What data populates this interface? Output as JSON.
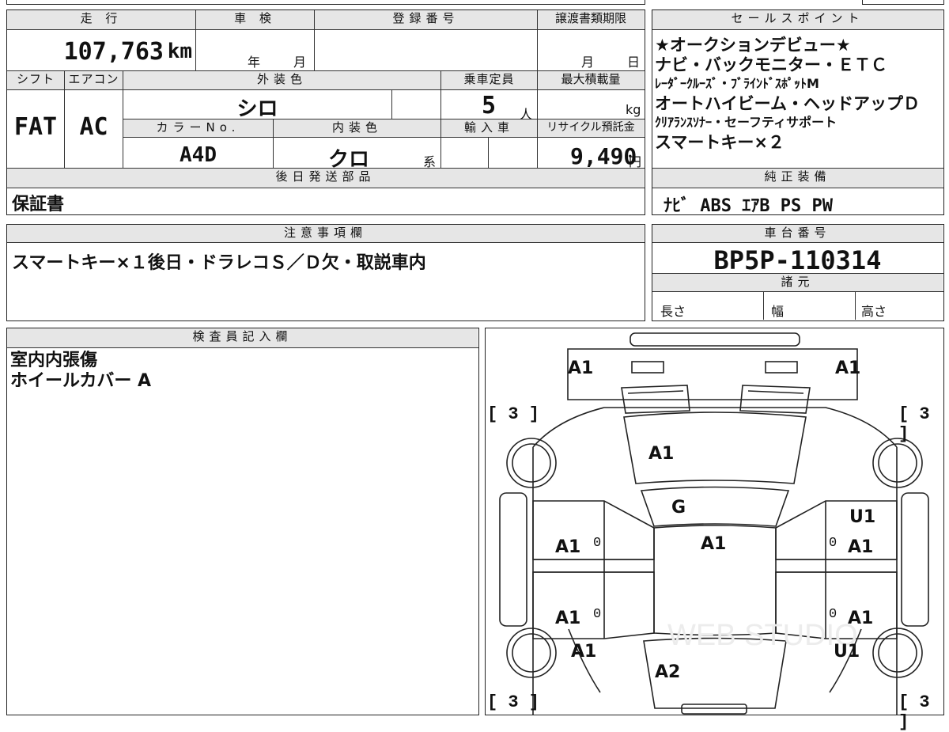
{
  "top_left": {
    "mileage_header": "走 行",
    "mileage": "107,763",
    "mileage_unit": "km",
    "shaken_header": "車 検",
    "shaken_year": "年",
    "shaken_month": "月",
    "registration_header": "登録番号",
    "deadline_header": "譲渡書類期限",
    "deadline_month": "月",
    "deadline_day": "日",
    "shift_header": "シフト",
    "ac_header": "エアコン",
    "ext_color_header": "外装色",
    "capacity_header": "乗車定員",
    "max_load_header": "最大積載量",
    "shift": "FAT",
    "ac": "AC",
    "ext_color": "シロ",
    "capacity": "5",
    "capacity_unit": "人",
    "max_load_unit": "kg",
    "color_no_header": "カラーNo.",
    "int_color_header": "内装色",
    "import_header": "輸入車",
    "recycle_header": "リサイクル預託金",
    "color_no": "A4D",
    "int_color": "クロ",
    "int_color_suffix": "系",
    "recycle_fee": "9,490",
    "recycle_unit": "円",
    "later_parts_header": "後日発送部品",
    "later_parts": "保証書"
  },
  "sales": {
    "header": "セールスポイント",
    "lines": [
      "★オークションデビュー★",
      "ナビ・バックモニター・ＥＴＣ",
      "ﾚｰﾀﾞｰｸﾙｰｽﾞ・ﾌﾞﾗｲﾝﾄﾞｽﾎﾟｯﾄM",
      "オートハイビーム・ヘッドアップＤ",
      "ｸﾘｱﾗﾝｽｿﾅｰ・セーフティサポート",
      "スマートキー×２"
    ],
    "equipment_header": "純正装備",
    "equipment": "ﾅﾋﾞ ABS ｴｱB PS PW"
  },
  "notes": {
    "header": "注意事項欄",
    "text": "スマートキー×１後日・ドラレコＳ／Ｄ欠・取説車内"
  },
  "chassis": {
    "header": "車台番号",
    "number": "BP5P-110314",
    "spec_header": "諸元",
    "length": "長さ",
    "width": "幅",
    "height": "高さ"
  },
  "inspector": {
    "header": "検査員記入欄",
    "lines": [
      "室内内張傷",
      "ホイールカバー A"
    ]
  },
  "diagram": {
    "marks": {
      "front_left": "A1",
      "front_right": "A1",
      "hood": "A1",
      "windshield": "G",
      "roof": "A1",
      "left_front_door": "A1",
      "left_rear_door": "A1",
      "right_front_door_upper": "U1",
      "right_front_door": "A1",
      "right_rear_door": "A1",
      "left_rear_fender": "A1",
      "right_rear_fender": "U1",
      "trunk": "A2",
      "zero_a": "0",
      "zero_b": "0",
      "zero_c": "0",
      "zero_d": "0",
      "corner_tl": "[ 3 ]",
      "corner_tr": "[ 3 ]",
      "corner_bl": "[ 3 ]",
      "corner_br": "[ 3 ]"
    }
  }
}
